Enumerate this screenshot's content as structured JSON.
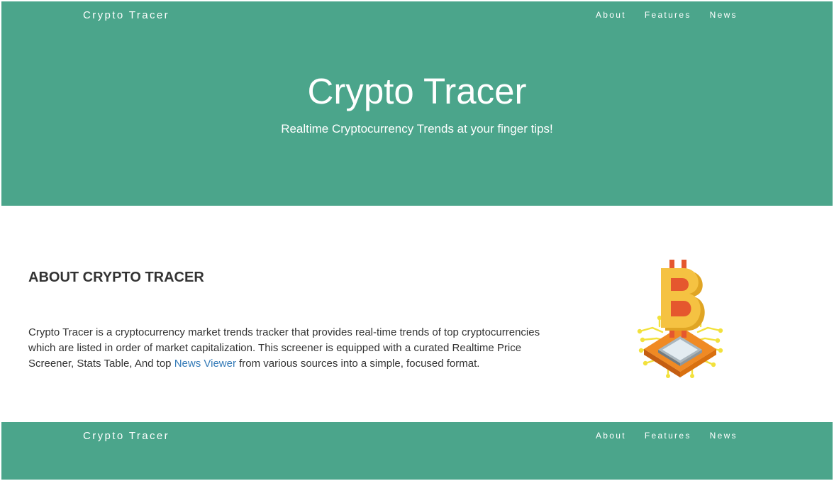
{
  "header": {
    "brand": "Crypto Tracer",
    "nav": {
      "about": "About",
      "features": "Features",
      "news": "News"
    }
  },
  "hero": {
    "title": "Crypto Tracer",
    "subtitle": "Realtime Cryptocurrency Trends at your finger tips!"
  },
  "about": {
    "heading": "ABOUT CRYPTO TRACER",
    "text_before_link": "Crypto Tracer is a cryptocurrency market trends tracker that provides real-time trends of top cryptocurrencies which are listed in order of market capitalization. This screener is equipped with a curated Realtime Price Screener, Stats Table, And top ",
    "link_text": "News Viewer",
    "text_after_link": " from various sources into a simple, focused format.",
    "image_icon": "bitcoin-chip-illustration"
  },
  "footer": {
    "brand": "Crypto Tracer",
    "nav": {
      "about": "About",
      "features": "Features",
      "news": "News"
    }
  },
  "colors": {
    "brand_green": "#4ba58b",
    "link_blue": "#337ab7",
    "text_dark": "#333333",
    "bitcoin_gold": "#f5c242",
    "chip_orange": "#f08a24"
  }
}
